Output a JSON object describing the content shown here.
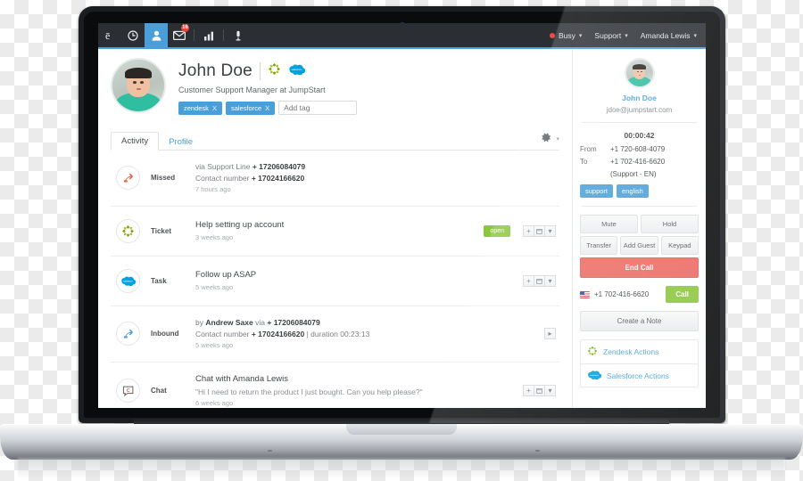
{
  "topnav": {
    "icons": [
      {
        "name": "brand-e-icon",
        "glyph": "e"
      },
      {
        "name": "clock-icon",
        "glyph": "clock"
      },
      {
        "name": "contacts-person-icon",
        "glyph": "person",
        "active": true
      },
      {
        "name": "mail-envelope-icon",
        "glyph": "envelope",
        "badge": "16"
      },
      {
        "name": "analytics-bars-icon",
        "glyph": "bars"
      },
      {
        "name": "dialpad-mic-icon",
        "glyph": "mic"
      }
    ],
    "status": {
      "label": "Busy",
      "color": "#ec4b48"
    },
    "support_menu": "Support",
    "user_menu": "Amanda Lewis",
    "accent": "#4a9fd8"
  },
  "profile": {
    "name": "John Doe",
    "title": "Customer Support Manager at JumpStart",
    "integration_icons": [
      "zendesk-logo-icon",
      "salesforce-logo-icon"
    ],
    "tags": [
      {
        "label": "zendesk",
        "remove": "X"
      },
      {
        "label": "salesforce",
        "remove": "X"
      }
    ],
    "add_tag_placeholder": "Add tag"
  },
  "tabs": [
    {
      "label": "Activity",
      "active": true
    },
    {
      "label": "Profile",
      "active": false
    }
  ],
  "tab_tools": [
    "gear-icon",
    "chevron-down-icon"
  ],
  "activity": [
    {
      "icon": "missed-call-arrow-icon",
      "icon_color": "#ef5b3c",
      "label": "Missed",
      "line1_pre": "via Support Line",
      "line1_strong": "+ 17206084079",
      "line2_pre": "Contact number",
      "line2_strong": "+ 17024166620",
      "ago": "7 hours ago",
      "pill": null,
      "buttons": [
        "plus-icon",
        "note-icon",
        "chevron-down-icon"
      ],
      "show_buttons": false
    },
    {
      "icon": "zendesk-logo-icon",
      "label": "Ticket",
      "title": "Help setting up account",
      "ago": "3 weeks ago",
      "pill": {
        "label": "open",
        "color": "#8cc63e"
      },
      "buttons": [
        "plus-icon",
        "note-icon",
        "chevron-down-icon"
      ],
      "show_buttons": true
    },
    {
      "icon": "salesforce-logo-icon",
      "label": "Task",
      "title": "Follow up ASAP",
      "ago": "5 weeks ago",
      "pill": null,
      "buttons": [
        "plus-icon",
        "note-icon",
        "chevron-down-icon"
      ],
      "show_buttons": true
    },
    {
      "icon": "inbound-call-arrow-icon",
      "icon_color": "#4a9fd8",
      "label": "Inbound",
      "line1_pre": "by",
      "line1_strong": "Andrew Saxe",
      "line1_mid": "via",
      "line1_strong2": "+ 17206084079",
      "line2_pre": "Contact number",
      "line2_strong": "+ 17024166620",
      "line2_post": "| duration 00:23:13",
      "ago": "5 weeks ago",
      "pill": null,
      "buttons": [
        "play-icon"
      ],
      "show_buttons": true
    },
    {
      "icon": "chat-bubble-icon",
      "label": "Chat",
      "title": "Chat with Amanda Lewis",
      "quote": "\"Hi I need to return the product I just bought. Can you help please?\"",
      "ago": "6 weeks ago",
      "pill": null,
      "buttons": [
        "plus-icon",
        "note-icon",
        "chevron-down-icon"
      ],
      "show_buttons": true
    }
  ],
  "right_panel": {
    "contact_name": "John Doe",
    "contact_email": "jdoe@jumpstart.com",
    "timer": "00:00:42",
    "from_label": "From",
    "from_value": "+1 720-608-4079",
    "to_label": "To",
    "to_value": "+1 702-416-6620",
    "queue": "(Support - EN)",
    "tags": [
      "support",
      "english"
    ],
    "call_controls_row1": [
      "Mute",
      "Hold"
    ],
    "call_controls_row2": [
      "Transfer",
      "Add Guest",
      "Keypad"
    ],
    "end_call": "End Call",
    "dial_number": "+1 702-416-6620",
    "dial_flag": "us-flag-icon",
    "call_button": "Call",
    "note_button": "Create a Note",
    "actions": [
      {
        "icon": "zendesk-logo-icon",
        "label": "Zendesk Actions"
      },
      {
        "icon": "salesforce-logo-icon",
        "label": "Salesforce Actions"
      }
    ]
  },
  "colors": {
    "accent_blue": "#4a9fd8",
    "green": "#8cc63e",
    "red": "#eb6a63",
    "nav_dark": "#2b2e33",
    "zendesk_green": "#78a300",
    "salesforce_blue": "#00a1e0"
  }
}
